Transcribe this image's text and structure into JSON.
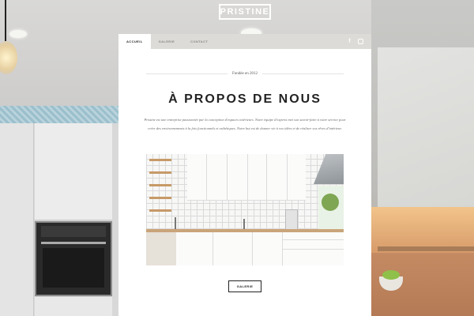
{
  "brand": {
    "logo_text": "PRISTINE"
  },
  "nav": {
    "tabs": [
      {
        "label": "ACCUEIL",
        "active": true
      },
      {
        "label": "GALERIE",
        "active": false
      },
      {
        "label": "CONTACT",
        "active": false
      }
    ],
    "social": [
      {
        "icon": "facebook-icon",
        "glyph": "f"
      },
      {
        "icon": "instagram-icon"
      }
    ]
  },
  "about": {
    "founded": "Fondée en 2012",
    "title": "À PROPOS DE NOUS",
    "description": "Pristine est une entreprise passionnée par la conception d'espaces intérieurs. Notre équipe d'experts met son savoir-faire à votre service pour créer des environnements à la fois fonctionnels et esthétiques. Notre but est de donner vie à vos idées et de réaliser vos rêves d'intérieur.",
    "button_label": "GALERIE"
  },
  "colors": {
    "accent": "#222222",
    "nav_bg": "#dddbd7",
    "card_bg": "#ffffff"
  }
}
